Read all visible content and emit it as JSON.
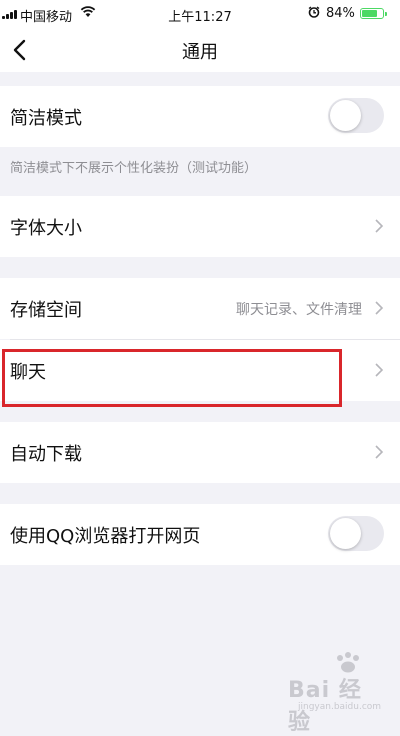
{
  "status_bar": {
    "carrier": "中国移动",
    "time": "上午11:27",
    "battery_percent": "84%",
    "battery_level": 0.84,
    "icons": [
      "signal-icon",
      "wifi-icon",
      "alarm-icon",
      "battery-icon"
    ]
  },
  "nav": {
    "title": "通用",
    "back_icon": "chevron-left-icon"
  },
  "settings": {
    "simple_mode": {
      "label": "简洁模式",
      "toggle_on": false
    },
    "simple_mode_desc": "简洁模式下不展示个性化装扮（测试功能）",
    "font_size": {
      "label": "字体大小"
    },
    "storage": {
      "label": "存储空间",
      "value": "聊天记录、文件清理"
    },
    "chat": {
      "label": "聊天"
    },
    "auto_download": {
      "label": "自动下载"
    },
    "qq_browser": {
      "label": "使用QQ浏览器打开网页",
      "toggle_on": false
    }
  },
  "watermark": {
    "text": "Bai 经验",
    "sub": "jingyan.baidu.com"
  },
  "colors": {
    "highlight": "#d9262b",
    "background": "#f2f2f7",
    "secondary_text": "#8e8e93",
    "battery": "#4cd964"
  }
}
